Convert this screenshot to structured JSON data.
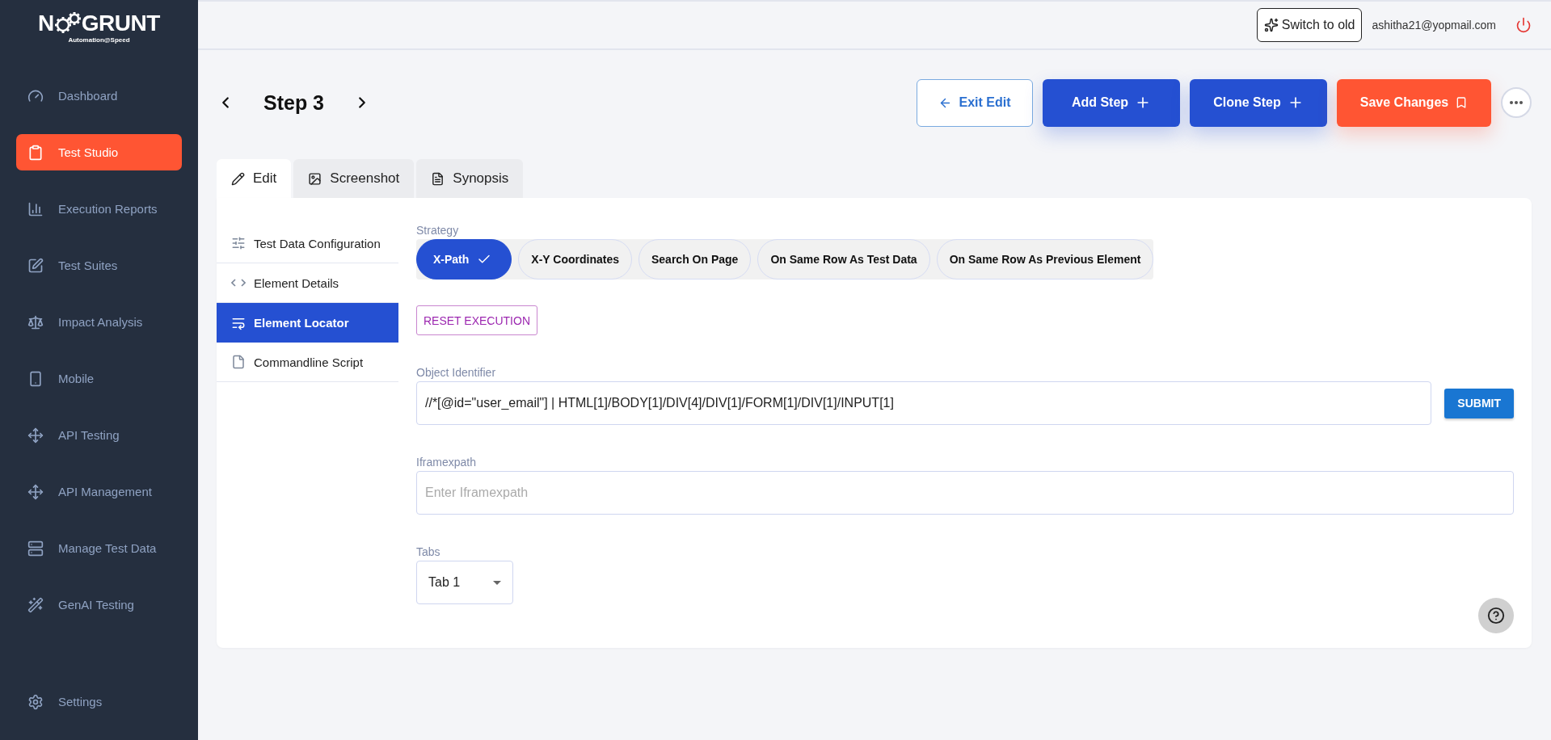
{
  "logo": {
    "name_start": "N",
    "name_end": "GRUNT",
    "tagline": "Automation@Speed"
  },
  "sidebar": {
    "items": [
      {
        "label": "Dashboard",
        "selected": false
      },
      {
        "label": "Test Studio",
        "selected": true
      },
      {
        "label": "Execution Reports",
        "selected": false
      },
      {
        "label": "Test Suites",
        "selected": false
      },
      {
        "label": "Impact Analysis",
        "selected": false
      },
      {
        "label": "Mobile",
        "selected": false
      },
      {
        "label": "API Testing",
        "selected": false
      },
      {
        "label": "API Management",
        "selected": false
      },
      {
        "label": "Manage Test Data",
        "selected": false
      },
      {
        "label": "GenAI Testing",
        "selected": false
      }
    ],
    "footer_item": {
      "label": "Settings",
      "selected": false
    }
  },
  "topbar": {
    "switch_button": "Switch to old",
    "user_email": "ashitha21@yopmail.com"
  },
  "step": {
    "title": "Step 3"
  },
  "actions": [
    {
      "label": "Exit Edit",
      "kind": "outline"
    },
    {
      "label": "Add Step",
      "kind": "primary"
    },
    {
      "label": "Clone Step",
      "kind": "primary"
    },
    {
      "label": "Save Changes",
      "kind": "accent"
    }
  ],
  "tabs": [
    {
      "label": "Edit",
      "selected": true
    },
    {
      "label": "Screenshot",
      "selected": false
    },
    {
      "label": "Synopsis",
      "selected": false
    }
  ],
  "section_menu": [
    {
      "label": "Test Data Configuration",
      "selected": false
    },
    {
      "label": "Element Details",
      "selected": false
    },
    {
      "label": "Element Locator",
      "selected": true
    },
    {
      "label": "Commandline Script",
      "selected": false
    }
  ],
  "strategy": {
    "label": "Strategy",
    "options": [
      {
        "label": "X-Path",
        "selected": true
      },
      {
        "label": "X-Y Coordinates",
        "selected": false
      },
      {
        "label": "Search On Page",
        "selected": false
      },
      {
        "label": "On Same Row As Test Data",
        "selected": false
      },
      {
        "label": "On Same Row As Previous Element",
        "selected": false
      }
    ]
  },
  "reset_button": "RESET EXECUTION",
  "object_identifier": {
    "label": "Object Identifier",
    "value": "//*[@id=\"user_email\"] | HTML[1]/BODY[1]/DIV[4]/DIV[1]/FORM[1]/DIV[1]/INPUT[1]",
    "submit": "SUBMIT"
  },
  "iframe_xpath": {
    "label": "Iframexpath",
    "placeholder": "Enter Iframexpath"
  },
  "tabs_select": {
    "label": "Tabs",
    "value": "Tab 1"
  }
}
